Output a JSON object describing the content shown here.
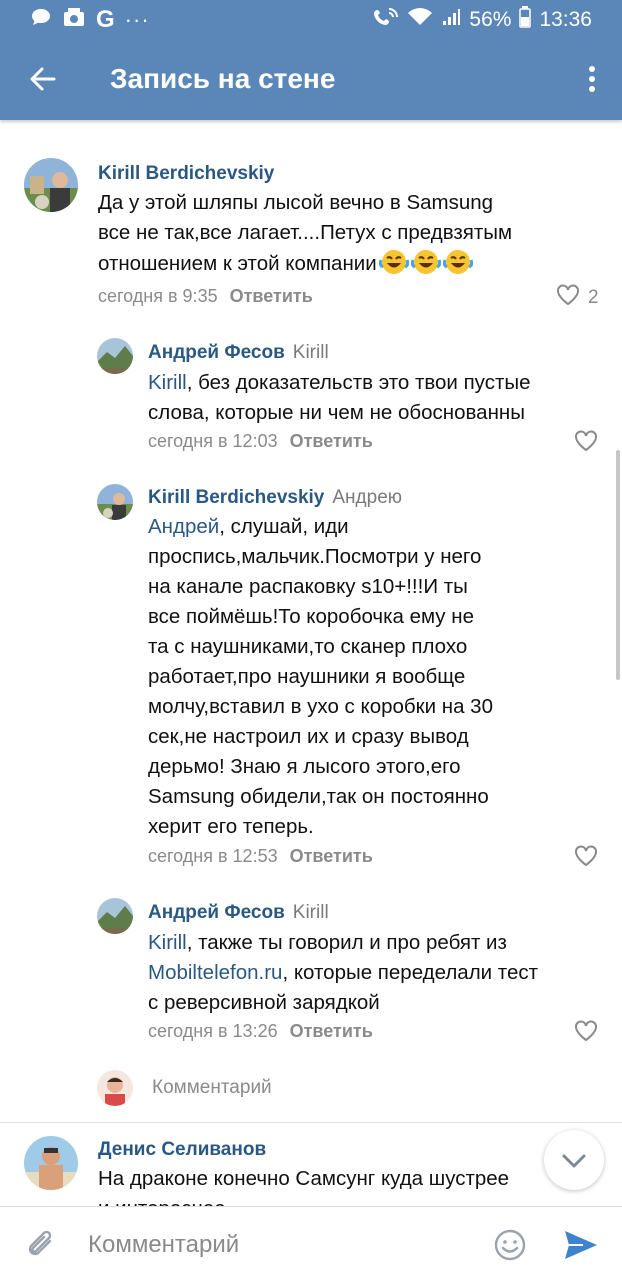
{
  "status_bar": {
    "left_icons": [
      "chat-bubble-icon",
      "stopwatch-icon",
      "google-g-icon",
      "more-dots-icon"
    ],
    "g_letter": "G",
    "dots": "···",
    "battery_pct": "56%",
    "time": "13:36"
  },
  "appbar": {
    "title": "Запись на стене",
    "back_icon": "back-arrow-icon",
    "more_icon": "vertical-dots-icon"
  },
  "comments": [
    {
      "author": "Kirill Berdichevskiy",
      "reply_to": "",
      "lines": [
        "Да у этой шляпы лысой вечно в Samsung",
        "все не так,все лагает....Петух с предвзятым",
        "отношением к этой компании"
      ],
      "emoji_count": "3",
      "time": "сегодня в 9:35",
      "reply_label": "Ответить",
      "likes": "2"
    },
    {
      "author": "Андрей Фесов",
      "reply_to": "Kirill",
      "mention": "Kirill",
      "lines": [
        ", без доказательств это твои пустые",
        "слова, которые ни чем не обоснованны"
      ],
      "time": "сегодня в 12:03",
      "reply_label": "Ответить"
    },
    {
      "author": "Kirill Berdichevskiy",
      "reply_to": "Андрею",
      "mention": "Андрей",
      "lines": [
        ", слушай, иди",
        "проспись,мальчик.Посмотри у него",
        "на канале распаковку s10+!!!И ты",
        "все поймёшь!То коробочка ему не",
        "та с наушниками,то сканер плохо",
        "работает,про наушники я вообще",
        "молчу,вставил в ухо с коробки на 30",
        "сек,не настроил их и сразу вывод",
        "дерьмо! Знаю я лысого этого,его",
        "Samsung обидели,так он постоянно",
        "херит его теперь."
      ],
      "time": "сегодня в 12:53",
      "reply_label": "Ответить"
    },
    {
      "author": "Андрей Фесов",
      "reply_to": "Kirill",
      "mention": "Kirill",
      "link": "Mobiltelefon.ru",
      "lines": [
        ", также ты говорил и про ребят из",
        ", которые переделали тест",
        "с реверсивной зарядкой"
      ],
      "time": "сегодня в 13:26",
      "reply_label": "Ответить"
    },
    {
      "author": "Денис Селиванов",
      "reply_to": "",
      "lines": [
        "На драконе конечно Самсунг куда шустрее",
        "и интереснее"
      ]
    }
  ],
  "reply_input": {
    "placeholder": "Комментарий"
  },
  "bottom_bar": {
    "placeholder": "Комментарий"
  },
  "colors": {
    "header": "#5b87b8",
    "link": "#2a5885",
    "meta": "#8a8a8a",
    "send": "#3f83cc"
  }
}
